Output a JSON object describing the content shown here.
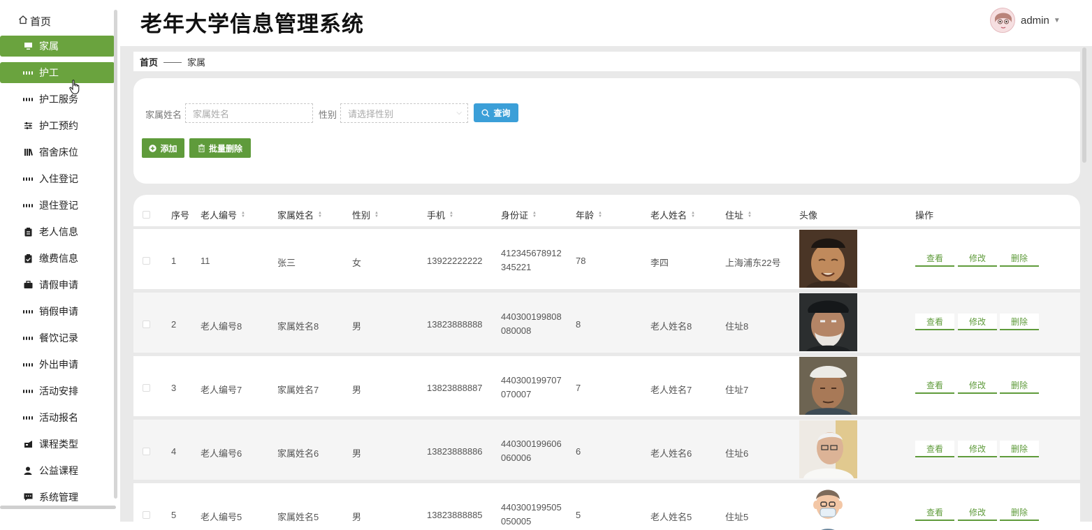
{
  "app": {
    "title": "老年大学信息管理系统",
    "user": "admin"
  },
  "sidebar": {
    "home": "首页",
    "items": [
      {
        "label": "家属",
        "icon": "monitor-icon",
        "active": true
      },
      {
        "label": "护工",
        "icon": "grid-icon",
        "active": true
      },
      {
        "label": "护工服务",
        "icon": "grid-icon"
      },
      {
        "label": "护工预约",
        "icon": "sliders-icon"
      },
      {
        "label": "宿舍床位",
        "icon": "library-icon"
      },
      {
        "label": "入住登记",
        "icon": "grid-icon"
      },
      {
        "label": "退住登记",
        "icon": "grid-icon"
      },
      {
        "label": "老人信息",
        "icon": "clipboard-icon"
      },
      {
        "label": "缴费信息",
        "icon": "clipboard-check-icon"
      },
      {
        "label": "请假申请",
        "icon": "briefcase-icon"
      },
      {
        "label": "销假申请",
        "icon": "grid-icon"
      },
      {
        "label": "餐饮记录",
        "icon": "grid-icon"
      },
      {
        "label": "外出申请",
        "icon": "grid-icon"
      },
      {
        "label": "活动安排",
        "icon": "grid-icon"
      },
      {
        "label": "活动报名",
        "icon": "grid-icon"
      },
      {
        "label": "课程类型",
        "icon": "tag-icon"
      },
      {
        "label": "公益课程",
        "icon": "user-icon"
      },
      {
        "label": "系统管理",
        "icon": "message-icon"
      }
    ]
  },
  "breadcrumb": {
    "home": "首页",
    "separator": "——",
    "current": "家属"
  },
  "search": {
    "name_label": "家属姓名",
    "name_placeholder": "家属姓名",
    "gender_label": "性别",
    "gender_placeholder": "请选择性别",
    "query": "查询",
    "add": "添加",
    "batch_delete": "批量删除"
  },
  "table": {
    "headers": [
      "序号",
      "老人编号",
      "家属姓名",
      "性别",
      "手机",
      "身份证",
      "年龄",
      "老人姓名",
      "住址",
      "头像",
      "操作"
    ],
    "actions": {
      "view": "查看",
      "edit": "修改",
      "delete": "删除"
    },
    "rows": [
      {
        "no": "1",
        "elder_no": "11",
        "name": "张三",
        "gender": "女",
        "phone": "13922222222",
        "id_card": "412345678912345221",
        "age": "78",
        "elder_name": "李四",
        "address": "上海浦东22号",
        "photo": "elderly-man-black-cap"
      },
      {
        "no": "2",
        "elder_no": "老人编号8",
        "name": "家属姓名8",
        "gender": "男",
        "phone": "13823888888",
        "id_card": "440300199808080008",
        "age": "8",
        "elder_name": "老人姓名8",
        "address": "住址8",
        "photo": "elderly-man-flat-cap"
      },
      {
        "no": "3",
        "elder_no": "老人编号7",
        "name": "家属姓名7",
        "gender": "男",
        "phone": "13823888887",
        "id_card": "440300199707070007",
        "age": "7",
        "elder_name": "老人姓名7",
        "address": "住址7",
        "photo": "elderly-man-white-cap"
      },
      {
        "no": "4",
        "elder_no": "老人编号6",
        "name": "家属姓名6",
        "gender": "男",
        "phone": "13823888886",
        "id_card": "440300199606060006",
        "age": "6",
        "elder_name": "老人姓名6",
        "address": "住址6",
        "photo": "elderly-man-glasses"
      },
      {
        "no": "5",
        "elder_no": "老人编号5",
        "name": "家属姓名5",
        "gender": "男",
        "phone": "13823888885",
        "id_card": "440300199505050005",
        "age": "5",
        "elder_name": "老人姓名5",
        "address": "住址5",
        "photo": "elderly-man-cartoon-mask"
      }
    ]
  },
  "colors": {
    "accent": "#6aa33e",
    "query_button": "#3b9fd8",
    "background": "#e9e9e9"
  }
}
